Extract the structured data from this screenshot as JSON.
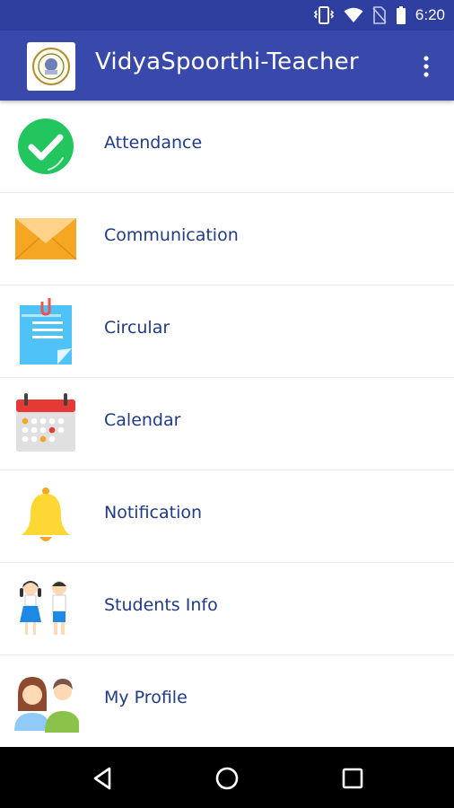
{
  "status_bar": {
    "time": "6:20",
    "icons": [
      "vibrate-icon",
      "wifi-icon",
      "no-sim-icon",
      "battery-icon"
    ],
    "color": "#2f3fa0"
  },
  "app_bar": {
    "title": "VidyaSpoorthi-Teacher",
    "color": "#3949ab",
    "logo": "school-logo",
    "menu_icon": "overflow-menu-icon"
  },
  "menu": {
    "items": [
      {
        "label": "Attendance",
        "icon": "check-circle-icon"
      },
      {
        "label": "Communication",
        "icon": "envelope-icon"
      },
      {
        "label": "Circular",
        "icon": "document-clip-icon"
      },
      {
        "label": "Calendar",
        "icon": "calendar-icon"
      },
      {
        "label": "Notification",
        "icon": "bell-icon"
      },
      {
        "label": "Students Info",
        "icon": "students-icon"
      },
      {
        "label": "My Profile",
        "icon": "profile-icon"
      }
    ],
    "label_color": "#1f3a8a"
  },
  "nav_bar": {
    "buttons": [
      "back-icon",
      "home-icon",
      "recents-icon"
    ]
  }
}
